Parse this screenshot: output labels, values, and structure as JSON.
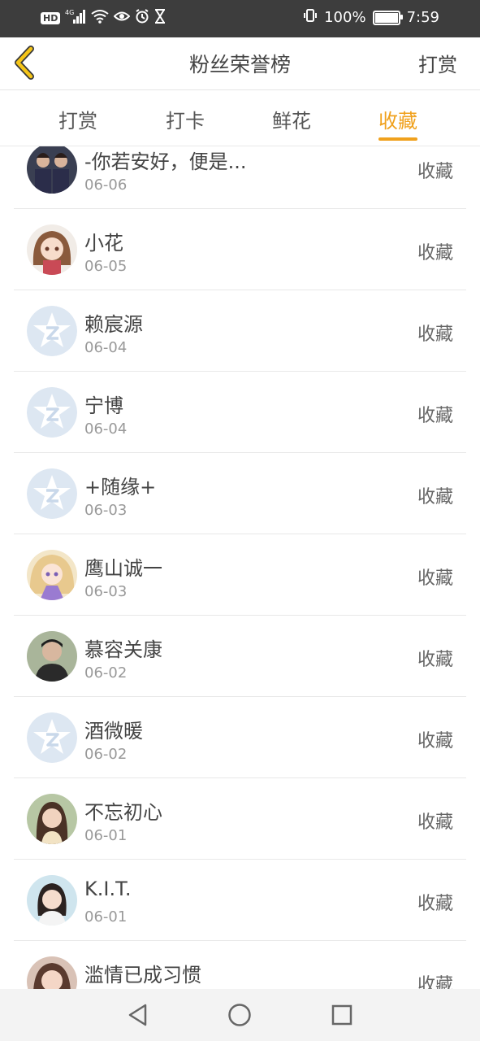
{
  "status_bar": {
    "hd": "HD",
    "network": "4G",
    "battery_percent": "100%",
    "time": "7:59",
    "icons": [
      "hd-icon",
      "signal-4g-icon",
      "wifi-icon",
      "eye-icon",
      "alarm-icon",
      "hourglass-icon",
      "vibrate-icon",
      "battery-icon"
    ]
  },
  "header": {
    "title": "粉丝荣誉榜",
    "action_label": "打赏",
    "back_icon": "chevron-left-icon",
    "back_color": "#f5c518"
  },
  "tabs": [
    {
      "label": "打赏",
      "active": false
    },
    {
      "label": "打卡",
      "active": false
    },
    {
      "label": "鲜花",
      "active": false
    },
    {
      "label": "收藏",
      "active": true
    }
  ],
  "accent_color": "#f0a11d",
  "fans": [
    {
      "name": "-你若安好，便是...",
      "date": "06-06",
      "action": "收藏",
      "avatar": "photo-avatar"
    },
    {
      "name": "小花",
      "date": "06-05",
      "action": "收藏",
      "avatar": "anime-avatar"
    },
    {
      "name": "赖宸源",
      "date": "06-04",
      "action": "收藏",
      "avatar": "default-avatar"
    },
    {
      "name": "宁博",
      "date": "06-04",
      "action": "收藏",
      "avatar": "default-avatar"
    },
    {
      "name": "+随缘+",
      "date": "06-03",
      "action": "收藏",
      "avatar": "default-avatar"
    },
    {
      "name": "鹰山诚一",
      "date": "06-03",
      "action": "收藏",
      "avatar": "anime-avatar"
    },
    {
      "name": "慕容关康",
      "date": "06-02",
      "action": "收藏",
      "avatar": "photo-avatar"
    },
    {
      "name": "酒微暖",
      "date": "06-02",
      "action": "收藏",
      "avatar": "default-avatar"
    },
    {
      "name": "不忘初心",
      "date": "06-01",
      "action": "收藏",
      "avatar": "photo-avatar"
    },
    {
      "name": "K.I.T.",
      "date": "06-01",
      "action": "收藏",
      "avatar": "photo-avatar"
    },
    {
      "name": "滥情已成习惯",
      "date": "",
      "action": "收藏",
      "avatar": "photo-avatar"
    }
  ],
  "system_nav": [
    "back-triangle-icon",
    "home-circle-icon",
    "recents-square-icon"
  ]
}
